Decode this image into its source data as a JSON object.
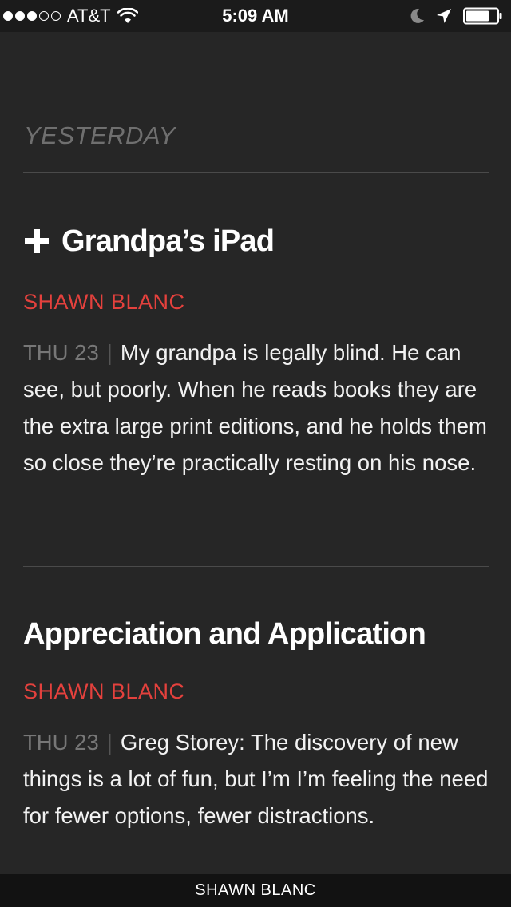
{
  "status_bar": {
    "carrier": "AT&T",
    "time": "5:09 AM",
    "signal_bars_filled": 3,
    "signal_bars_total": 5,
    "battery_level": 0.75,
    "icons": [
      "wifi-icon",
      "moon-icon",
      "location-icon",
      "battery-icon"
    ]
  },
  "section": {
    "title": "YESTERDAY"
  },
  "articles": [
    {
      "title": "Grandpa’s iPad",
      "has_plus_icon": true,
      "author": "SHAWN BLANC",
      "date": "THU 23",
      "separator": "|",
      "excerpt": "My grandpa is legally blind. He can see, but poorly. When he reads books they are the extra large print editions, and he holds them so close they’re practically resting on his nose."
    },
    {
      "title": "Appreciation and Application",
      "has_plus_icon": false,
      "author": "SHAWN BLANC",
      "date": "THU 23",
      "separator": "|",
      "excerpt": "Greg Storey: The discovery of new things is a lot of fun, but I’m I’m feeling the need for fewer options, fewer distractions."
    }
  ],
  "footer": {
    "label": "SHAWN BLANC"
  },
  "colors": {
    "background": "#262626",
    "accent_author": "#e4413d",
    "section_title": "#6f6f6f",
    "date": "#777777"
  }
}
